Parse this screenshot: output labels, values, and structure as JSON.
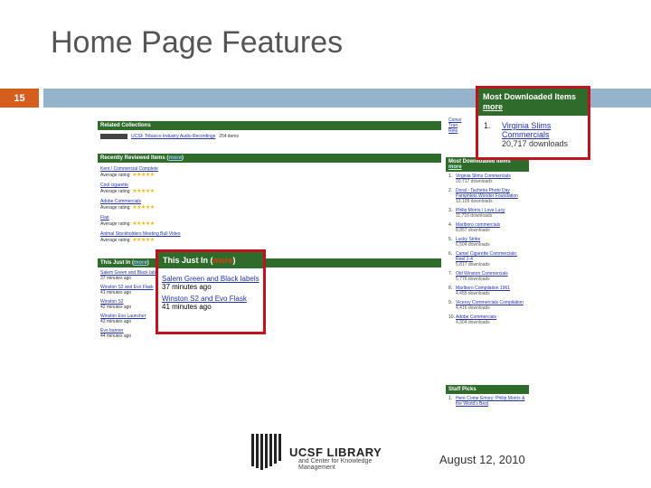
{
  "slide": {
    "title": "Home Page Features",
    "number": "15",
    "date": "August  12, 2010",
    "logo_title": "UCSF LIBRARY",
    "logo_subtitle": "and Center for Knowledge Management"
  },
  "colors": {
    "accent_orange": "#d55e1f",
    "header_bar": "#95b3cc",
    "section_green": "#2f6b2b",
    "callout_red": "#c1131f",
    "link_blue": "#2233aa",
    "star_gold": "#f0b81a"
  },
  "related": {
    "header": "Related Collections",
    "item_label": "UCSF Tobacco Industry Audio Recordings",
    "item_count": "254 items"
  },
  "recent": {
    "header_prefix": "Recently Reviewed Items (",
    "header_more": "more",
    "header_suffix": ")",
    "rating_label": "Average rating:",
    "items": [
      {
        "title": "Kent / Commercial Complete",
        "stars": "★★★★★"
      },
      {
        "title": "Cool cigarette",
        "stars": "★★★★★"
      },
      {
        "title": "Adobe Commercials",
        "stars": "★★★★★"
      },
      {
        "title": "Flair",
        "stars": "★★★★★"
      },
      {
        "title": "Animal Stockholders Meeting Bull Video",
        "stars": "★★★★★"
      }
    ]
  },
  "just_in": {
    "header_prefix": "This Just In (",
    "header_more": "more",
    "header_suffix": ")",
    "items": [
      {
        "title": "Salem Green and Black labels",
        "time": "37 minutes ago"
      },
      {
        "title": "Winston S2 and Evo Flask",
        "time": "41 minutes ago"
      },
      {
        "title": "Winston S2",
        "time": "42 minutes ago"
      },
      {
        "title": "Winston Evo Launcher",
        "time": "43 minutes ago"
      },
      {
        "title": "Evo banner",
        "time": "44 minutes ago"
      }
    ]
  },
  "most_downloaded": {
    "header": "Most Downloaded Items",
    "more": "more",
    "items": [
      {
        "n": "1.",
        "title": "Virginia Slims Commercials",
        "downloads": "20,717 downloads"
      },
      {
        "n": "2.",
        "title": "Doral - Tacheria Photo Day Pamphlets Wonder Foundation",
        "downloads": "13,109 downloads"
      },
      {
        "n": "3.",
        "title": "Philip Morris / Love Lucy",
        "downloads": "11,716 downloads"
      },
      {
        "n": "4.",
        "title": "Marlboro commercials",
        "downloads": "8,857 downloads"
      },
      {
        "n": "5.",
        "title": "Lucky Strike",
        "downloads": "6,504 downloads"
      },
      {
        "n": "6.",
        "title": "Camel Cigarette Commercials: Reel 1-4",
        "downloads": "5,817 downloads"
      },
      {
        "n": "7.",
        "title": "Old Winston Commercials",
        "downloads": "5,776 downloads"
      },
      {
        "n": "8.",
        "title": "Marlboro Compilation 1961",
        "downloads": "4,455 downloads"
      },
      {
        "n": "9.",
        "title": "Viceroy Commercials Compilation",
        "downloads": "4,416 downloads"
      },
      {
        "n": "10.",
        "title": "Adobe Commercials",
        "downloads": "4,304 downloads"
      }
    ]
  },
  "top_right": {
    "lines": [
      "Convo",
      "Tran",
      "Rele"
    ]
  },
  "staff_picks": {
    "header": "Staff Picks",
    "items": [
      {
        "n": "1.",
        "title": "Here Come Emory: Philip Morris & the World's Best"
      }
    ]
  },
  "callout_most": {
    "header": "Most Downloaded Items",
    "more": "more",
    "n": "1.",
    "title": "Virginia Slims Commercials",
    "downloads": "20,717 downloads"
  },
  "callout_just": {
    "header_prefix": "This Just In (",
    "header_more": "more",
    "header_suffix": ")",
    "items": [
      {
        "title": "Salem Green and Black labels",
        "time": "37 minutes ago"
      },
      {
        "title": "Winston S2 and Evo Flask",
        "time": "41 minutes ago"
      }
    ]
  }
}
